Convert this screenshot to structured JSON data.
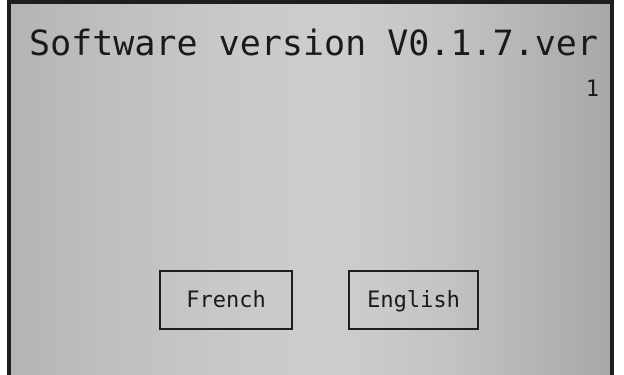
{
  "screen": {
    "title": "Software version V0.1.7.ver",
    "page_number": "1"
  },
  "buttons": {
    "french_label": "French",
    "english_label": "English"
  }
}
